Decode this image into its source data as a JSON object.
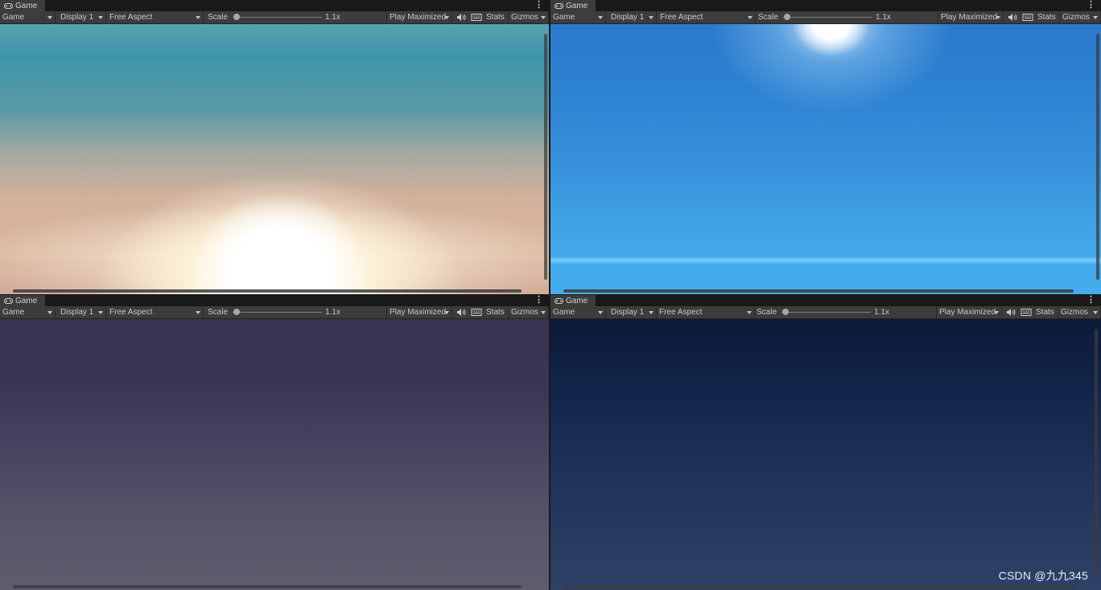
{
  "panels": [
    {
      "id": "tl",
      "tab_label": "Game",
      "mode": "Game",
      "display": "Display 1",
      "aspect": "Free Aspect",
      "scale_label": "Scale",
      "scale_value": "1.1x",
      "play_mode": "Play Maximized",
      "stats": "Stats",
      "gizmos": "Gizmos",
      "scene": "sunset sky with bright sun on horizon"
    },
    {
      "id": "tr",
      "tab_label": "Game",
      "mode": "Game",
      "display": "Display 1",
      "aspect": "Free Aspect",
      "scale_label": "Scale",
      "scale_value": "1.1x",
      "play_mode": "Play Maximized",
      "stats": "Stats",
      "gizmos": "Gizmos",
      "scene": "clear blue daytime sky with sun at top"
    },
    {
      "id": "bl",
      "tab_label": "Game",
      "mode": "Game",
      "display": "Display 1",
      "aspect": "Free Aspect",
      "scale_label": "Scale",
      "scale_value": "1.1x",
      "play_mode": "Play Maximized",
      "stats": "Stats",
      "gizmos": "Gizmos",
      "scene": "purple dusk sky"
    },
    {
      "id": "br",
      "tab_label": "Game",
      "mode": "Game",
      "display": "Display 1",
      "aspect": "Free Aspect",
      "scale_label": "Scale",
      "scale_value": "1.1x",
      "play_mode": "Play Maximized",
      "stats": "Stats",
      "gizmos": "Gizmos",
      "scene": "dark blue night sky"
    }
  ],
  "watermark": "CSDN @九九345",
  "icons": {
    "tab": "gamepad-icon",
    "audio": "speaker-icon",
    "stats_layout": "keyboard-grid-icon",
    "menu": "kebab-menu-icon"
  },
  "colors": {
    "toolbar": "#3c3c3c",
    "tabbar": "#191919",
    "text": "#c8c8c8"
  }
}
